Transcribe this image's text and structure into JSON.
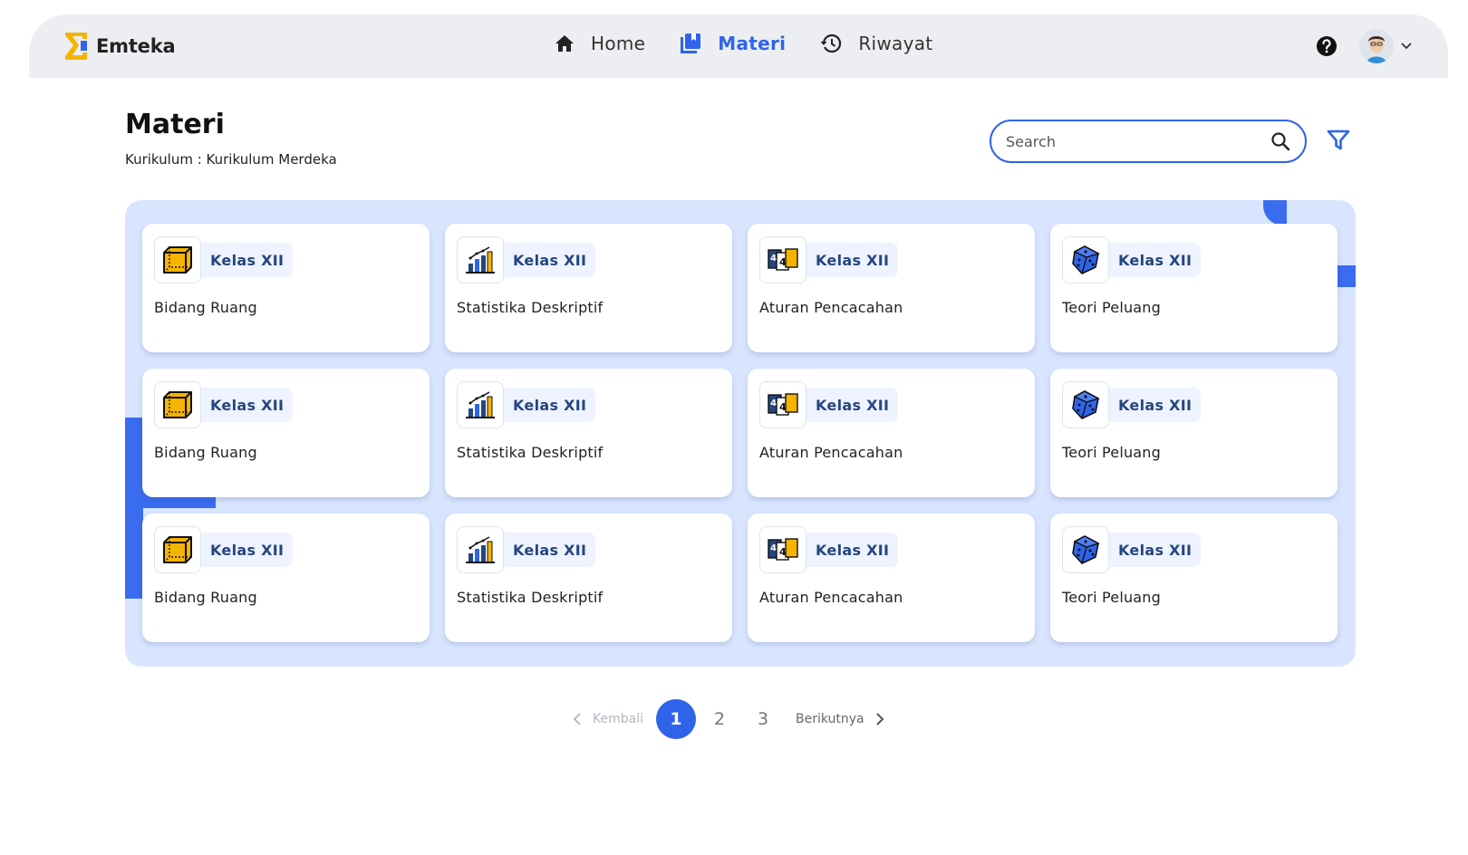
{
  "brand": {
    "name": "Emteka",
    "accent": "#f5b400"
  },
  "nav": {
    "items": [
      {
        "label": "Home",
        "icon": "home-icon",
        "active": false
      },
      {
        "label": "Materi",
        "icon": "book-icon",
        "active": true
      },
      {
        "label": "Riwayat",
        "icon": "history-icon",
        "active": false
      }
    ]
  },
  "page": {
    "title": "Materi",
    "subtitle": "Kurikulum : Kurikulum Merdeka"
  },
  "search": {
    "placeholder": "Search",
    "value": ""
  },
  "cards": [
    {
      "level": "Kelas XII",
      "title": "Bidang Ruang",
      "icon": "cube-icon"
    },
    {
      "level": "Kelas XII",
      "title": "Statistika Deskriptif",
      "icon": "bar-chart-icon"
    },
    {
      "level": "Kelas XII",
      "title": "Aturan Pencacahan",
      "icon": "counting-cards-icon"
    },
    {
      "level": "Kelas XII",
      "title": "Teori Peluang",
      "icon": "dice-icon"
    },
    {
      "level": "Kelas XII",
      "title": "Bidang Ruang",
      "icon": "cube-icon"
    },
    {
      "level": "Kelas XII",
      "title": "Statistika Deskriptif",
      "icon": "bar-chart-icon"
    },
    {
      "level": "Kelas XII",
      "title": "Aturan Pencacahan",
      "icon": "counting-cards-icon"
    },
    {
      "level": "Kelas XII",
      "title": "Teori Peluang",
      "icon": "dice-icon"
    },
    {
      "level": "Kelas XII",
      "title": "Bidang Ruang",
      "icon": "cube-icon"
    },
    {
      "level": "Kelas XII",
      "title": "Statistika Deskriptif",
      "icon": "bar-chart-icon"
    },
    {
      "level": "Kelas XII",
      "title": "Aturan Pencacahan",
      "icon": "counting-cards-icon"
    },
    {
      "level": "Kelas XII",
      "title": "Teori Peluang",
      "icon": "dice-icon"
    }
  ],
  "pagination": {
    "prev_label": "Kembali",
    "next_label": "Berikutnya",
    "pages": [
      "1",
      "2",
      "3"
    ],
    "current": "1"
  },
  "colors": {
    "primary": "#2f64ea",
    "card_area_bg": "#d9e5ff",
    "chip_text": "#24467f"
  }
}
